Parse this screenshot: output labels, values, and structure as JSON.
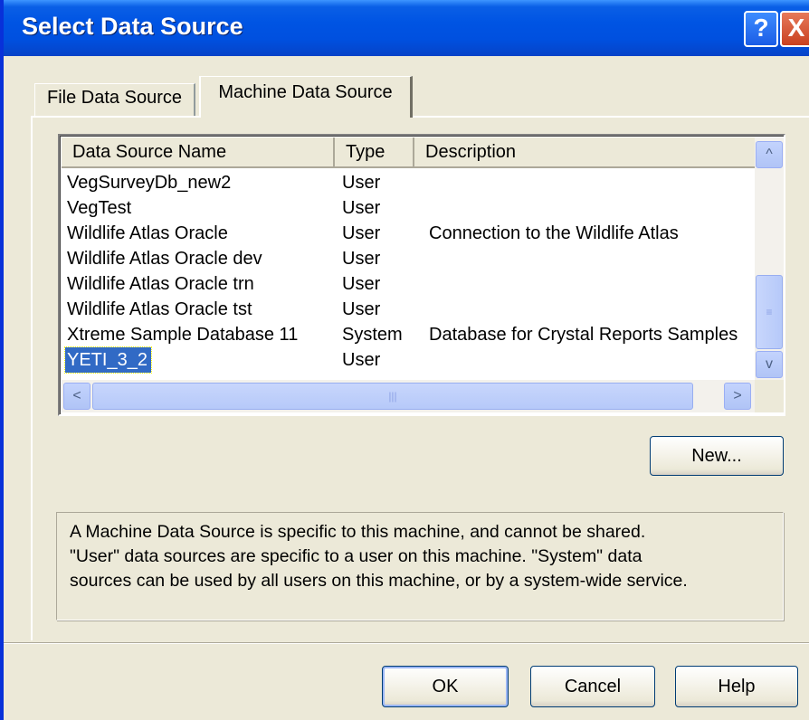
{
  "window": {
    "title": "Select Data Source",
    "help_glyph": "?",
    "close_glyph": "X"
  },
  "tabs": [
    {
      "label": "File Data Source",
      "active": false
    },
    {
      "label": "Machine Data Source",
      "active": true
    }
  ],
  "list": {
    "columns": [
      "Data Source Name",
      "Type",
      "Description"
    ],
    "rows": [
      {
        "name": "VegSurveyDb_new2",
        "type": "User",
        "description": ""
      },
      {
        "name": "VegTest",
        "type": "User",
        "description": ""
      },
      {
        "name": "Wildlife Atlas Oracle",
        "type": "User",
        "description": "Connection to the Wildlife Atlas"
      },
      {
        "name": "Wildlife Atlas Oracle dev",
        "type": "User",
        "description": ""
      },
      {
        "name": "Wildlife Atlas Oracle trn",
        "type": "User",
        "description": ""
      },
      {
        "name": "Wildlife Atlas Oracle tst",
        "type": "User",
        "description": ""
      },
      {
        "name": "Xtreme Sample Database 11",
        "type": "System",
        "description": "Database for Crystal Reports Samples"
      },
      {
        "name": "YETI_3_2",
        "type": "User",
        "description": "",
        "selected": true
      }
    ],
    "scroll_up_glyph": "^",
    "scroll_down_glyph": "v",
    "scroll_left_glyph": "<",
    "scroll_right_glyph": ">",
    "thumb_grip": "|||"
  },
  "buttons": {
    "new": "New...",
    "ok": "OK",
    "cancel": "Cancel",
    "help": "Help"
  },
  "info": {
    "line1": "A Machine Data Source is specific to this machine, and cannot be shared.",
    "line2": "\"User\" data sources are specific to a user on this machine.  \"System\" data",
    "line3": "sources can be used by all users on this machine, or by a system-wide service."
  },
  "colors": {
    "titlebar": "#0054e3",
    "selection": "#316ac5",
    "face": "#ece9d8"
  }
}
